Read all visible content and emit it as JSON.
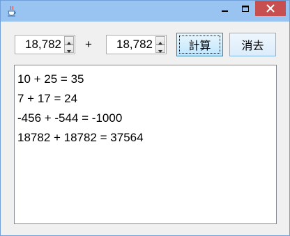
{
  "window": {
    "app_icon": "java-cup-icon",
    "controls": [
      "minimize-icon",
      "maximize-icon",
      "close-icon"
    ]
  },
  "form": {
    "spinner_a_value": "18,782",
    "operator": "+",
    "spinner_b_value": "18,782",
    "calc_button": "計算",
    "clear_button": "消去"
  },
  "output": {
    "lines": [
      "10 + 25 = 35",
      "7 + 17 = 24",
      "-456 + -544 = -1000",
      "18782 + 18782 = 37564"
    ]
  },
  "colors": {
    "title_bar": "#99c3f0",
    "close_button": "#c74f4f",
    "focused_button": "#bee6fd"
  }
}
